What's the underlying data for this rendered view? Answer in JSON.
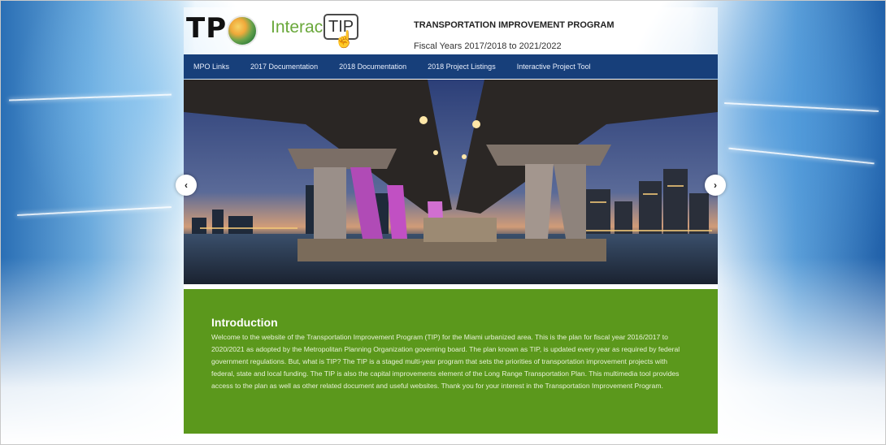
{
  "header": {
    "logo_tpo": "TP",
    "logo_interac": "Interac",
    "logo_tip": "TIP",
    "program_title": "TRANSPORTATION IMPROVEMENT PROGRAM",
    "fiscal_years": "Fiscal Years 2017/2018 to 2021/2022"
  },
  "nav": {
    "items": [
      {
        "label": "MPO Links"
      },
      {
        "label": "2017 Documentation"
      },
      {
        "label": "2018 Documentation"
      },
      {
        "label": "2018 Project Listings"
      },
      {
        "label": "Interactive Project Tool"
      }
    ]
  },
  "carousel": {
    "prev_icon": "chevron-left-icon",
    "next_icon": "chevron-right-icon",
    "prev_glyph": "‹",
    "next_glyph": "›"
  },
  "intro": {
    "title": "Introduction",
    "body": "Welcome to the website of the Transportation Improvement Program (TIP) for the Miami urbanized area. This is the plan for fiscal year 2016/2017 to 2020/2021 as adopted by the Metropolitan Planning Organization governing board. The plan known as TIP, is updated every year as required by federal government regulations. But, what is TIP? The TIP is a staged multi-year program that sets the priorities of transportation improvement projects with federal, state and local funding. The TIP is also the capital improvements element of the Long Range Transportation Plan. This multimedia tool provides access to the plan as well as other related document and useful websites. Thank you for your interest in the Transportation Improvement Program."
  },
  "colors": {
    "nav_bg": "#173f7a",
    "intro_bg": "#5b981c",
    "interac_green": "#6aa83b"
  }
}
